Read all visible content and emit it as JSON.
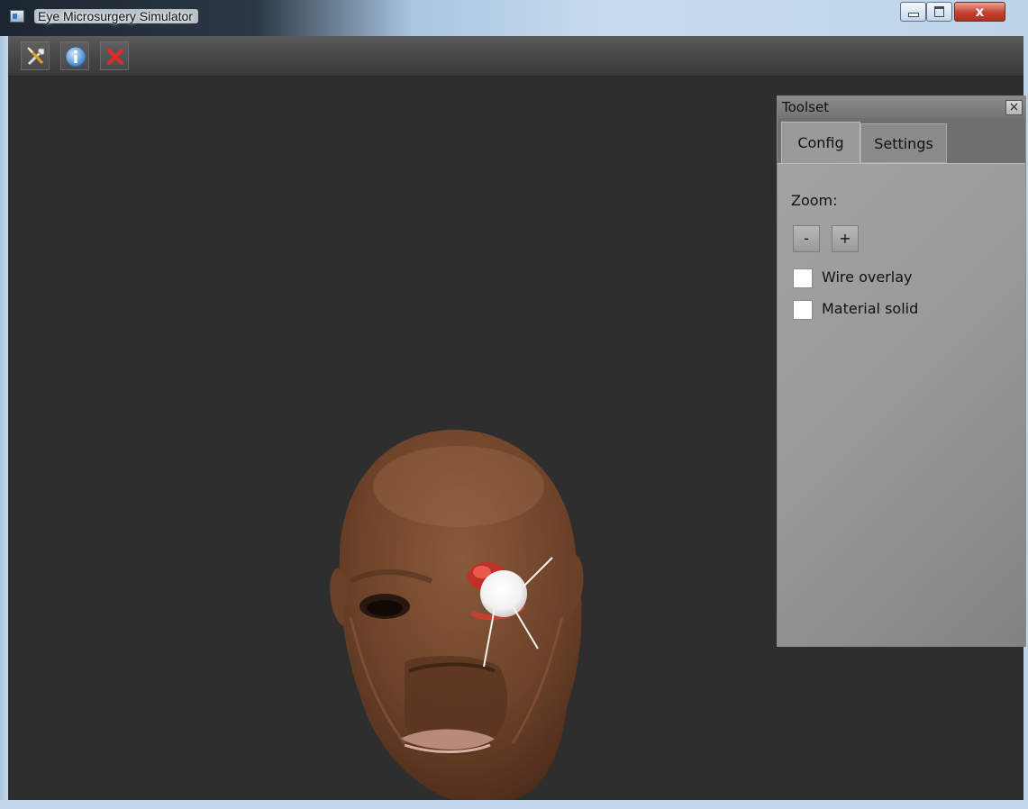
{
  "window": {
    "title": "Eye Microsurgery Simulator",
    "close_glyph": "x"
  },
  "toolbar": {
    "buttons": [
      {
        "icon": "tools-icon"
      },
      {
        "icon": "info-icon"
      },
      {
        "icon": "exit-icon"
      }
    ]
  },
  "toolset": {
    "title": "Toolset",
    "close_glyph": "×",
    "tabs": [
      {
        "label": "Config",
        "selected": true
      },
      {
        "label": "Settings",
        "selected": false
      }
    ],
    "config": {
      "zoom_label": "Zoom:",
      "zoom_out": "-",
      "zoom_in": "+",
      "checkboxes": [
        {
          "label": "Wire overlay",
          "checked": false
        },
        {
          "label": "Material solid",
          "checked": false
        }
      ]
    }
  },
  "colors": {
    "viewport_bg": "#2e2e2e",
    "toolbar_bg": "#4a4a4a",
    "panel_bg": "#9a9a9a",
    "skin": "#7a4a30"
  }
}
